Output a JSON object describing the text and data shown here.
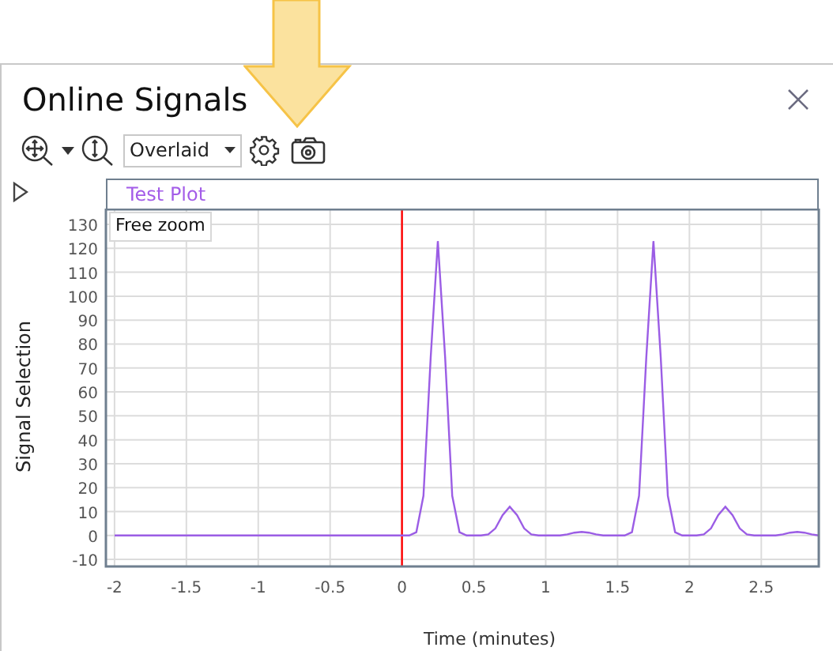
{
  "window": {
    "title": "Online Signals"
  },
  "toolbar": {
    "view_mode": "Overlaid"
  },
  "plot": {
    "title": "Test Plot",
    "zoom_mode": "Free zoom",
    "chart_data": {
      "type": "line",
      "xlabel": "Time (minutes)",
      "ylabel": "Signal Selection",
      "grid": true,
      "xlim": [
        -2.06,
        2.9
      ],
      "ylim": [
        -12.6,
        136.6
      ],
      "xticks": [
        -2,
        -1.5,
        -1,
        -0.5,
        0,
        0.5,
        1,
        1.5,
        2,
        2.5
      ],
      "yticks": [
        -10,
        0,
        10,
        20,
        30,
        40,
        50,
        60,
        70,
        80,
        90,
        100,
        110,
        120,
        130
      ],
      "x": [
        -2,
        0,
        0.05,
        0.1,
        0.15,
        0.2,
        0.25,
        0.3,
        0.35,
        0.4,
        0.45,
        0.5,
        0.55,
        0.6,
        0.65,
        0.7,
        0.75,
        0.8,
        0.85,
        0.9,
        0.95,
        1,
        1.05,
        1.1,
        1.15,
        1.2,
        1.25,
        1.3,
        1.35,
        1.4,
        1.45,
        1.5,
        1.55,
        1.6,
        1.65,
        1.7,
        1.75,
        1.8,
        1.85,
        1.9,
        1.95,
        2,
        2.05,
        2.1,
        2.15,
        2.2,
        2.25,
        2.3,
        2.35,
        2.4,
        2.45,
        2.5,
        2.55,
        2.6,
        2.65,
        2.7,
        2.75,
        2.8,
        2.85,
        2.9
      ],
      "series": [
        {
          "color": "#9b5de5",
          "values": [
            0,
            0,
            0,
            1.4,
            16.6,
            74.7,
            123,
            74.7,
            16.6,
            1.4,
            0,
            0,
            0,
            0.5,
            3,
            8.5,
            12,
            8.5,
            3,
            0.5,
            0,
            0,
            0,
            0,
            0.5,
            1.2,
            1.5,
            1.2,
            0.5,
            0,
            0,
            0,
            0,
            1.4,
            16.6,
            74.7,
            123,
            74.7,
            16.6,
            1.4,
            0,
            0,
            0,
            0.5,
            3,
            8.5,
            12,
            8.5,
            3,
            0.5,
            0,
            0,
            0,
            0,
            0.5,
            1.2,
            1.5,
            1.2,
            0.5,
            0
          ]
        }
      ],
      "ref_lines": [
        {
          "axis": "x",
          "value": 0,
          "color": "#ff0000"
        }
      ]
    }
  }
}
